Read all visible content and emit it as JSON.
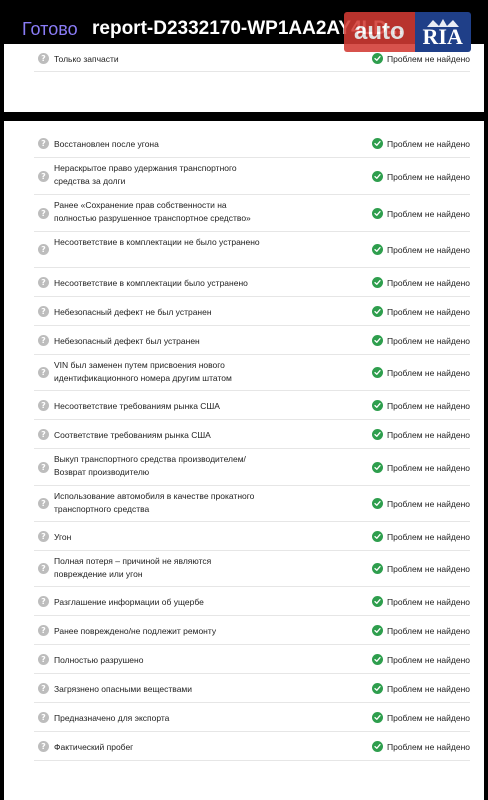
{
  "header": {
    "done_label": "Готово",
    "title": "report-D2332170-WP1AA2AY4LD...",
    "logo_auto": "auto",
    "logo_ria": "RIA"
  },
  "status_text": "Проблем не найдено",
  "first_card_rows": [
    {
      "label": "Только запчасти"
    }
  ],
  "rows": [
    {
      "label": "Восстановлен после угона"
    },
    {
      "label": "Нераскрытое право удержания транспортного средства за долги"
    },
    {
      "label": "Ранее «Сохранение прав собственности на полностью разрушенное транспортное средство»"
    },
    {
      "label": "Несоответствие в комплектации не было устранено"
    },
    {
      "label": "Несоответствие в комплектации было устранено"
    },
    {
      "label": "Небезопасный дефект не был устранен"
    },
    {
      "label": "Небезопасный дефект был устранен"
    },
    {
      "label": "VIN был заменен путем присвоения нового идентификационного номера другим штатом"
    },
    {
      "label": "Несоответствие требованиям рынка США"
    },
    {
      "label": "Соответствие требованиям рынка США"
    },
    {
      "label": "Выкуп транспортного средства производителем/ Возврат производителю"
    },
    {
      "label": "Использование автомобиля в качестве прокатного транспортного средства"
    },
    {
      "label": "Угон"
    },
    {
      "label": "Полная потеря – причиной не являются повреждение или угон"
    },
    {
      "label": "Разглашение информации об ущербе"
    },
    {
      "label": "Ранее повреждено/не подлежит ремонту"
    },
    {
      "label": "Полностью разрушено"
    },
    {
      "label": "Загрязнено опасными веществами"
    },
    {
      "label": "Предназначено для экспорта"
    },
    {
      "label": "Фактический пробег"
    }
  ]
}
